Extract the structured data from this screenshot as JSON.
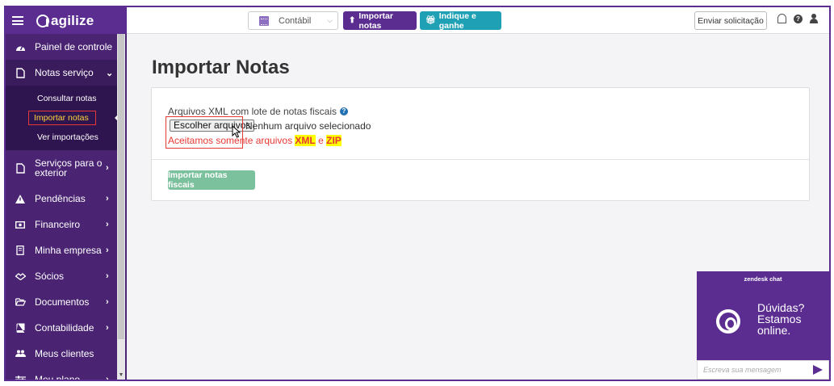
{
  "brand": {
    "name": "agilize",
    "primary_color": "#5b2d91",
    "sidebar_color": "#4a2473"
  },
  "sidebar": {
    "items": [
      {
        "label": "Painel de controle",
        "icon": "dashboard-icon"
      },
      {
        "label": "Notas serviço",
        "icon": "document-icon",
        "expanded": true,
        "children": [
          {
            "label": "Consultar notas"
          },
          {
            "label": "Importar notas",
            "active": true
          },
          {
            "label": "Ver importações"
          }
        ]
      },
      {
        "label": "Serviços para o exterior",
        "icon": "document-icon"
      },
      {
        "label": "Pendências",
        "icon": "warning-icon"
      },
      {
        "label": "Financeiro",
        "icon": "money-icon"
      },
      {
        "label": "Minha empresa",
        "icon": "building-icon"
      },
      {
        "label": "Sócios",
        "icon": "handshake-icon"
      },
      {
        "label": "Documentos",
        "icon": "folder-icon"
      },
      {
        "label": "Contabilidade",
        "icon": "book-icon"
      },
      {
        "label": "Meus clientes",
        "icon": "users-icon"
      },
      {
        "label": "Meu plano",
        "icon": "sliders-icon"
      }
    ]
  },
  "topbar": {
    "context_select": "Contábil",
    "import_button": "Importar notas",
    "refer_button": "Indique e ganhe",
    "send_request_button": "Enviar solicitação"
  },
  "main": {
    "title": "Importar Notas",
    "field_label": "Arquivos XML com lote de notas fiscais",
    "file_button": "Escolher arquivos",
    "file_status": "Nenhum arquivo selecionado",
    "hint_prefix": "Aceitamos somente arquivos",
    "hint_xml": "XML",
    "hint_and": "e",
    "hint_zip": "ZIP",
    "submit_button": "Importar notas fiscais"
  },
  "chat": {
    "title": "zendesk chat",
    "message_line1": "Dúvidas?",
    "message_line2": "Estamos",
    "message_line3": "online.",
    "input_placeholder": "Escreva sua mensagem"
  }
}
